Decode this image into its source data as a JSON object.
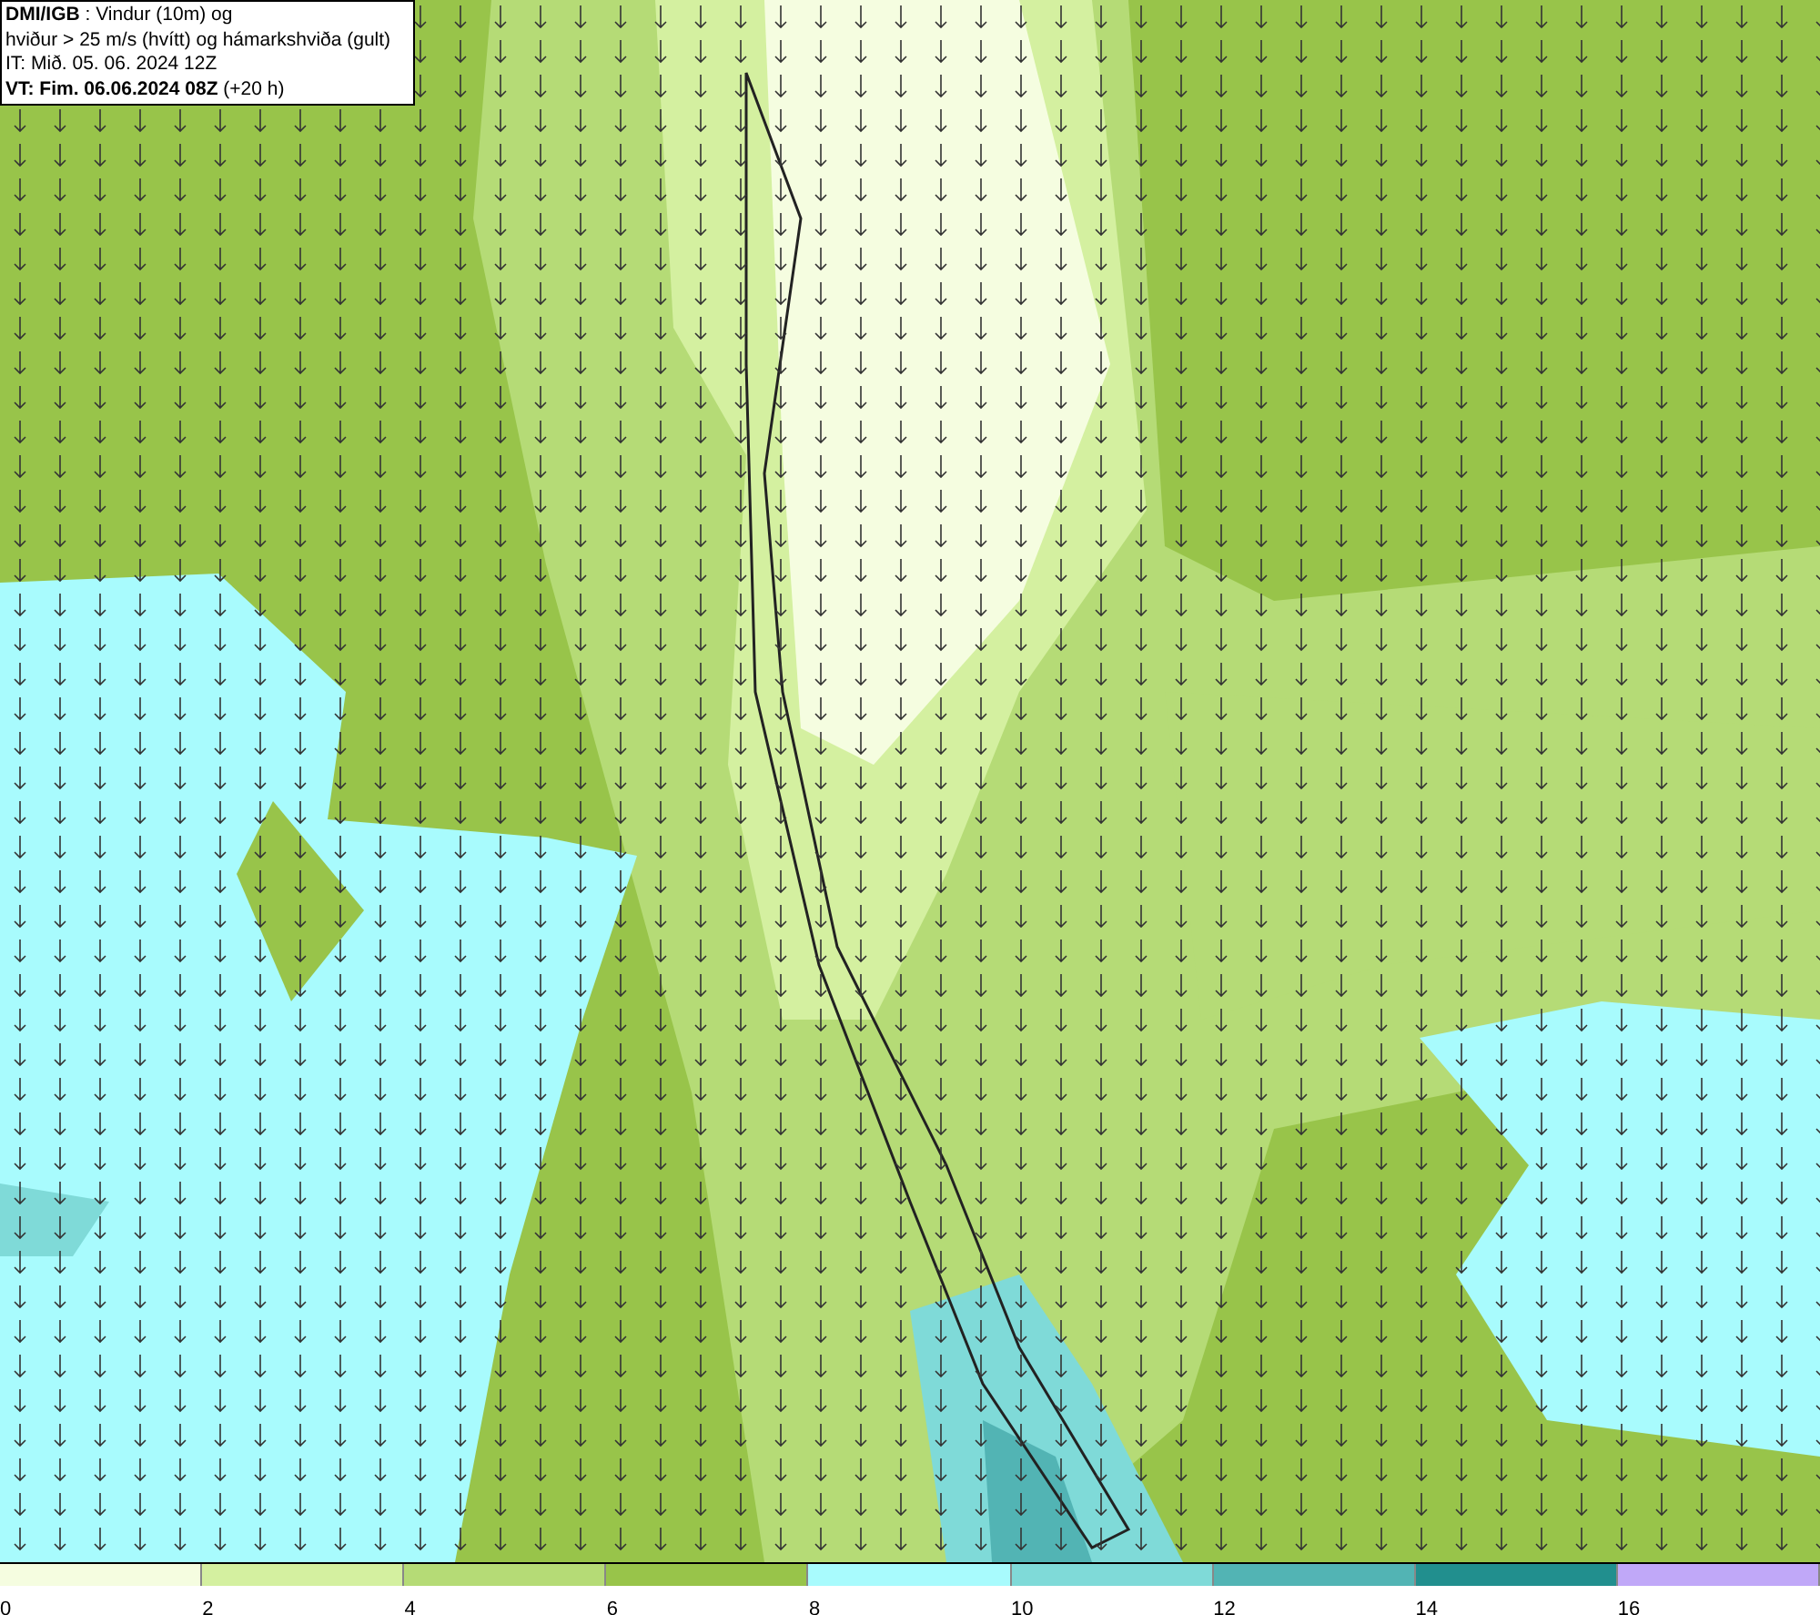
{
  "header": {
    "lines": [
      "**DMI/IGB** : Vindur (10m) og",
      "hviður > 25 m/s (hvítt) og hámarkshviða (gult)",
      "IT: Mið. 05. 06. 2024 12Z",
      "**VT: Fim. 06.06.2024 08Z** (+20 h)"
    ]
  },
  "legend": [
    {
      "label": "0",
      "color": "#f5fde0"
    },
    {
      "label": "2",
      "color": "#d4f0a0"
    },
    {
      "label": "4",
      "color": "#b5db76"
    },
    {
      "label": "6",
      "color": "#98c44a"
    },
    {
      "label": "8",
      "color": "#a8fbfd"
    },
    {
      "label": "10",
      "color": "#7fdad8"
    },
    {
      "label": "12",
      "color": "#52b4b4"
    },
    {
      "label": "14",
      "color": "#218f8e"
    },
    {
      "label": "16",
      "color": "#c0a8f8"
    }
  ]
}
